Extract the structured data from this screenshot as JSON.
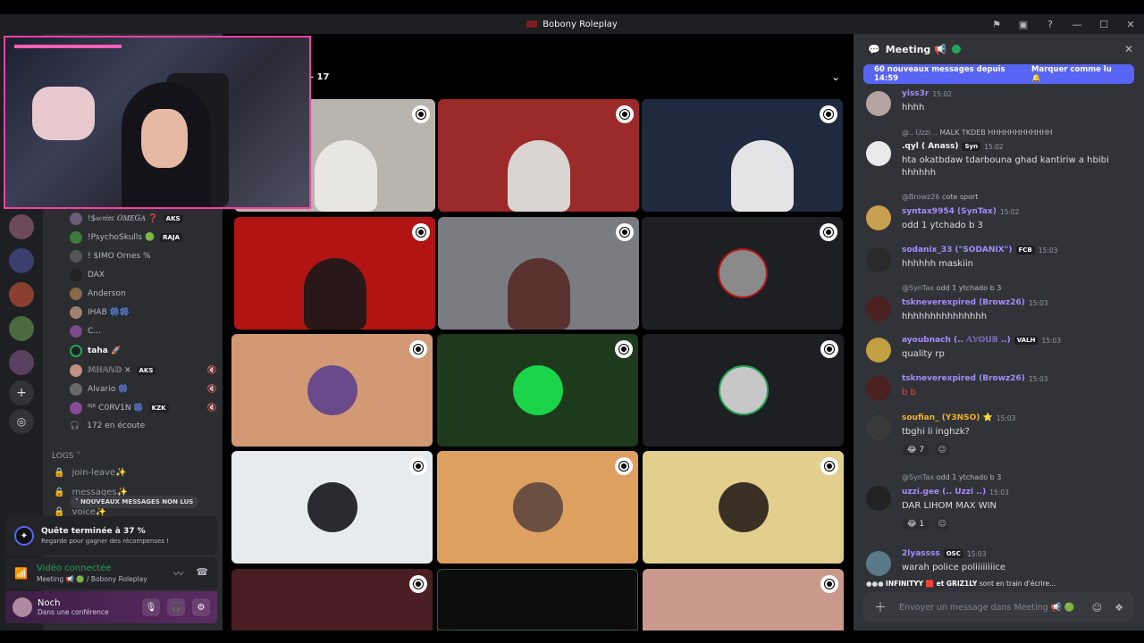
{
  "window": {
    "title": "Bobony Roleplay"
  },
  "titlebar_icons": [
    "flag-icon",
    "inbox-icon",
    "help-icon",
    "minimize-icon",
    "maximize-icon",
    "close-icon"
  ],
  "titlebar_glyphs": [
    "⚑",
    "▣",
    "?",
    "—",
    "☐",
    "✕"
  ],
  "stage": {
    "count": "– 17"
  },
  "members": [
    {
      "name": "!$𝔰𝔢𝔫𝔦𝔬𝔯 𝑂𝑀𝐸𝐺𝐴 ❓",
      "tag": "AKS",
      "color": "#b5bac1",
      "muted": false
    },
    {
      "name": "!PsychoSkulls 🟢",
      "tag": "RAJA",
      "color": "#b5bac1",
      "muted": false
    },
    {
      "name": "! $IMO Ornes %",
      "tag": "",
      "color": "#b5bac1",
      "muted": false
    },
    {
      "name": "DAX",
      "tag": "",
      "color": "#b5bac1",
      "muted": false
    },
    {
      "name": "Anderson",
      "tag": "",
      "color": "#b5bac1",
      "muted": false
    },
    {
      "name": "IHAB 🎆🎆",
      "tag": "",
      "color": "#b5bac1",
      "muted": false
    },
    {
      "name": "C...",
      "tag": "",
      "color": "#b5bac1",
      "muted": false
    },
    {
      "name": "taha 🚀",
      "tag": "",
      "color": "#f2f3f5",
      "muted": false
    },
    {
      "name": "𝕄ℍ𝔸ℕ𝔻 ✕",
      "tag": "AKS",
      "color": "#b5bac1",
      "muted": true
    },
    {
      "name": "Alvario 🎆",
      "tag": "",
      "color": "#b5bac1",
      "muted": true
    },
    {
      "name": "ᴿᴶᴷ C0RV1N 🎆",
      "tag": "KZK",
      "color": "#b5bac1",
      "muted": true
    }
  ],
  "listeners": "172 en écoute",
  "logs_category": "LOGS ˅",
  "channels": [
    "join-leave✨",
    "messages✨",
    "voice✨"
  ],
  "unread_pill": "NOUVEAUX MESSAGES NON LUS",
  "quest": {
    "title": "Quête terminée à 37 %",
    "subtitle": "Regarde pour gagner des récompenses !"
  },
  "voice": {
    "title": "Vidéo connectée",
    "subtitle": "Meeting 📢 🟢 / Bobony Roleplay"
  },
  "user": {
    "name": "Noch",
    "status": "Dans une conférence"
  },
  "chat": {
    "title": "Meeting 📢",
    "new_messages": "60 nouveaux messages depuis 14:59",
    "mark_read": "Marquer comme lu",
    "messages": [
      {
        "reply": "",
        "reply_text": "",
        "name": "yiss3r",
        "name_color": "#a78bfa",
        "badge": "",
        "time": "15:02",
        "text": "hhhh"
      },
      {
        "reply": "@.. Uzzi ..",
        "reply_text": "MALK TKDEB HHHHHHHHHHHH",
        "name": ".qyl ( Anass)",
        "name_color": "#f2f3f5",
        "badge": "Syn",
        "time": "15:02",
        "text": "hta okatbdaw tdarbouna ghad kantiriw a hbibi",
        "text2": "hhhhhh"
      },
      {
        "reply": "@Browz26",
        "reply_text": "cote sport",
        "name": "syntax9954 (SynTax)",
        "name_color": "#a78bfa",
        "badge": "",
        "time": "15:02",
        "text": "odd 1 ytchado b 3"
      },
      {
        "reply": "",
        "reply_text": "",
        "name": "sodanix_33 (\"SODANIX\")",
        "name_color": "#a78bfa",
        "badge": "FCB",
        "time": "15:03",
        "text": "hhhhhh maskiin"
      },
      {
        "reply": "@SynTax",
        "reply_text": "odd 1 ytchado b 3",
        "name": "tskneverexpired (Browz26)",
        "name_color": "#a78bfa",
        "badge": "",
        "time": "15:03",
        "text": "hhhhhhhhhhhhhhh"
      },
      {
        "reply": "",
        "reply_text": "",
        "name": "ayoubnach (.. 𝔸𝕐𝕆𝕌𝔹 ..)",
        "name_color": "#a78bfa",
        "badge": "VALH",
        "time": "15:03",
        "text": "quality rp"
      },
      {
        "reply": "",
        "reply_text": "",
        "name": "tskneverexpired (Browz26)",
        "name_color": "#a78bfa",
        "badge": "",
        "time": "15:03",
        "text": "b b"
      },
      {
        "reply": "",
        "reply_text": "",
        "name": "soufian_ (Y3NSO) ⭐",
        "name_color": "#f0b232",
        "badge": "",
        "time": "15:03",
        "text": "tbghi li inghzk?"
      },
      {
        "reply": "@SynTax",
        "reply_text": "odd 1 ytchado b 3",
        "name": "uzzi.gee (.. Uzzi ..)",
        "name_color": "#a78bfa",
        "badge": "",
        "time": "15:03",
        "text": "DAR LIHOM MAX WIN"
      },
      {
        "reply": "",
        "reply_text": "",
        "name": "2lyassss",
        "name_color": "#a78bfa",
        "badge": "OSC",
        "time": "15:03",
        "text": "warah police poliiiiiiiice"
      }
    ],
    "reactions": [
      {
        "emoji": "😂",
        "count": "7"
      },
      {
        "emoji": "😂",
        "count": "1"
      }
    ],
    "typing_names": "INFINITYY 🟥 et GRIZ1LY",
    "typing_suffix": "sont en train d'écrire...",
    "composer_placeholder": "Envoyer un message dans Meeting 📢 🟢"
  },
  "colors": {
    "accent": "#5865f2",
    "online": "#23a55a",
    "cam_border": "#ff3fa4"
  }
}
